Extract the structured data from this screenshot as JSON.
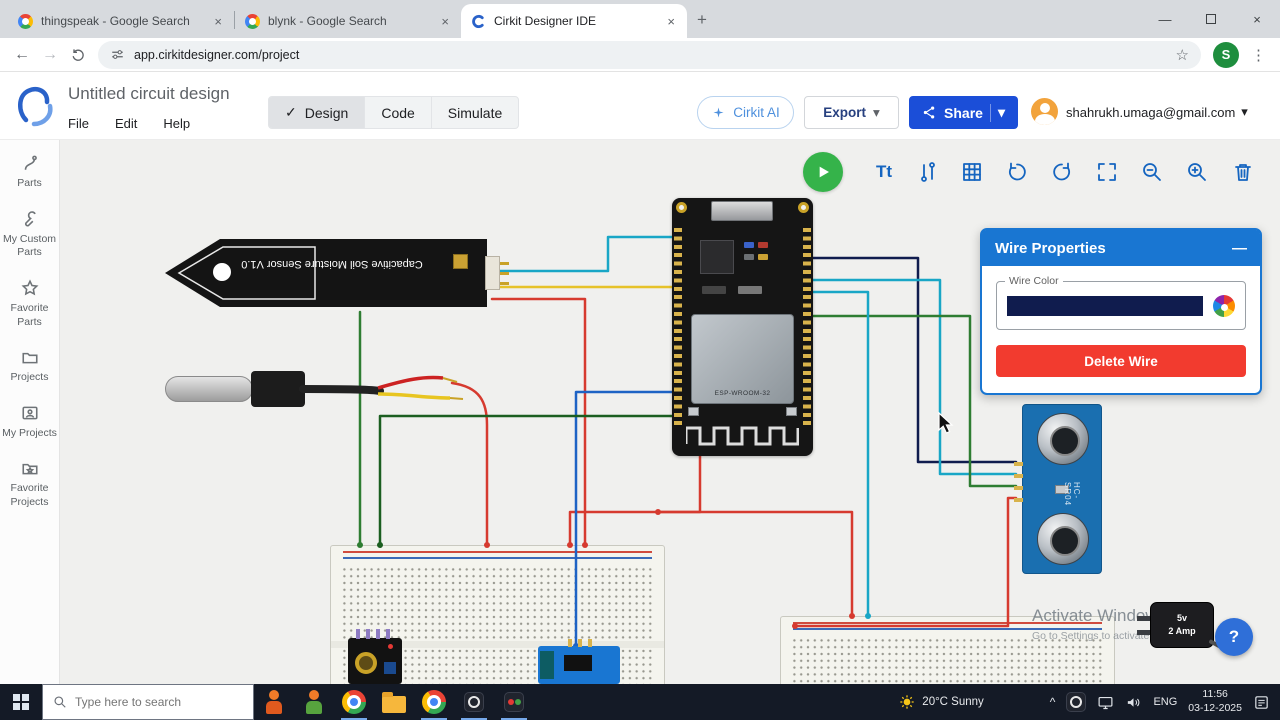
{
  "browser": {
    "tabs": [
      {
        "label": "thingspeak - Google Search"
      },
      {
        "label": "blynk - Google Search"
      },
      {
        "label": "Cirkit Designer IDE"
      }
    ],
    "url": "app.cirkitdesigner.com/project",
    "profile_initial": "S"
  },
  "glyphs": {
    "back": "←",
    "forward": "→",
    "new_tab": "+",
    "close": "×",
    "minimize": "—",
    "star": "☆",
    "menu": "⋮",
    "caret": "▾",
    "check": "✓",
    "tray_caret": "^"
  },
  "app": {
    "title": "Untitled circuit design",
    "menu": {
      "file": "File",
      "edit": "Edit",
      "help": "Help"
    },
    "modes": {
      "design": "Design",
      "code": "Code",
      "simulate": "Simulate"
    },
    "cirkit_ai_label": "Cirkit AI",
    "export_label": "Export",
    "share_label": "Share",
    "account_email": "shahrukh.umaga@gmail.com"
  },
  "sidebar": {
    "items": [
      {
        "label": "Parts"
      },
      {
        "label": "My Custom Parts"
      },
      {
        "label": "Favorite Parts"
      },
      {
        "label": "Projects"
      },
      {
        "label": "My Projects"
      },
      {
        "label": "Favorite Projects"
      }
    ]
  },
  "toolbar": {
    "text_tool": "Tt"
  },
  "wire_properties": {
    "title": "Wire Properties",
    "color_label": "Wire Color",
    "color_value": "#101c4e",
    "delete_label": "Delete Wire"
  },
  "components": {
    "soil_sensor": "Capacitive Soil Moisture Sensor V1.0",
    "esp32": "ESP-WROOM-32",
    "ultrasonic": "HC-SR04",
    "adapter_line1": "5v",
    "adapter_line2": "2 Amp"
  },
  "watermark": {
    "line1": "Activate Windows",
    "line2": "Go to Settings to activate Windows."
  },
  "help_button": "?",
  "taskbar": {
    "search_placeholder": "Type here to search",
    "weather": "20°C Sunny",
    "language": "ENG",
    "time": "11:56",
    "date": "03-12-2025"
  },
  "colors": {
    "share_blue": "#1b4ed8",
    "panel_header_blue": "#1976d2",
    "delete_red": "#f23b2f",
    "play_green": "#35b34a",
    "toolbar_icon_blue": "#1565c0",
    "wire_selected": "#101c4e"
  }
}
